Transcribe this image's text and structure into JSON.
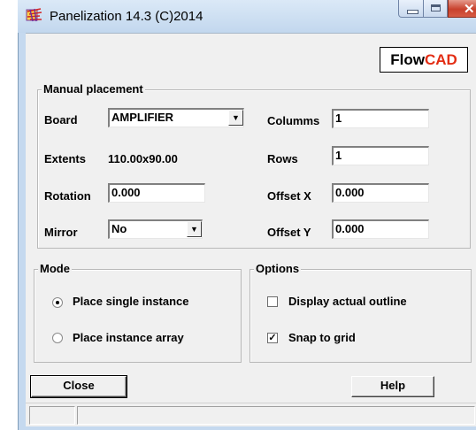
{
  "window": {
    "title": "Panelization 14.3 (C)2014"
  },
  "logo": {
    "part1": "Flow",
    "part2": "CAD"
  },
  "manual": {
    "group_title": "Manual placement",
    "board_label": "Board",
    "board_value": "AMPLIFIER",
    "extents_label": "Extents",
    "extents_value": "110.00x90.00",
    "rotation_label": "Rotation",
    "rotation_value": "0.000",
    "mirror_label": "Mirror",
    "mirror_value": "No",
    "columns_label": "Columms",
    "columns_value": "1",
    "rows_label": "Rows",
    "rows_value": "1",
    "offsetx_label": "Offset X",
    "offsetx_value": "0.000",
    "offsety_label": "Offset Y",
    "offsety_value": "0.000"
  },
  "mode": {
    "group_title": "Mode",
    "single_label": "Place single instance",
    "single_selected": true,
    "array_label": "Place instance array",
    "array_selected": false
  },
  "options": {
    "group_title": "Options",
    "outline_label": "Display actual outline",
    "outline_checked": false,
    "snap_label": "Snap to grid",
    "snap_checked": true
  },
  "buttons": {
    "close_label": "Close",
    "help_label": "Help"
  },
  "icons": {
    "app": "panelization-app-icon",
    "minimize": "minimize-icon",
    "maximize": "maximize-icon",
    "close": "close-icon"
  },
  "colors": {
    "brand_red": "#e32d14",
    "titlebar": "#c5d9ef",
    "close_button": "#c8412c"
  }
}
